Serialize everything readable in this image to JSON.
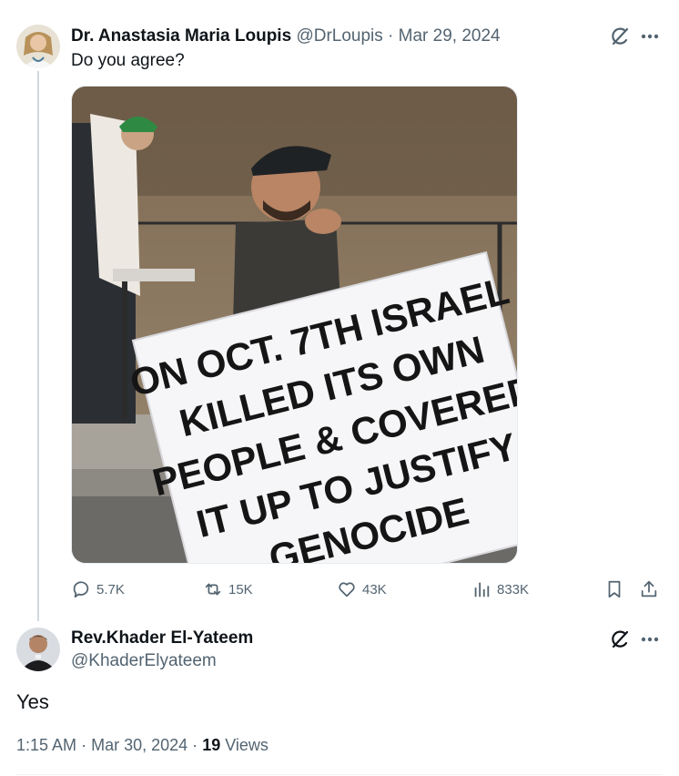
{
  "tweet": {
    "author_name": "Dr. Anastasia Maria Loupis",
    "author_handle": "@DrLoupis",
    "separator": "·",
    "date": "Mar 29, 2024",
    "text": "Do you agree?",
    "sign_text": [
      "ON OCT. 7TH ISRAEL",
      "KILLED ITS OWN",
      "PEOPLE & COVERED",
      "IT UP TO JUSTIFY",
      "GENOCIDE"
    ],
    "stats": {
      "replies": "5.7K",
      "reposts": "15K",
      "likes": "43K",
      "views": "833K"
    },
    "icons": {
      "reply": "reply-icon",
      "repost": "repost-icon",
      "like": "heart-icon",
      "views": "views-chart-icon",
      "bookmark": "bookmark-icon",
      "share": "share-icon",
      "grok": "grok-icon",
      "more": "more-icon"
    }
  },
  "reply": {
    "author_name": "Rev.Khader El-Yateem",
    "author_handle": "@KhaderElyateem",
    "text": "Yes",
    "time": "1:15 AM",
    "separator": "·",
    "date": "Mar 30, 2024",
    "views_count": "19",
    "views_label": "Views"
  }
}
